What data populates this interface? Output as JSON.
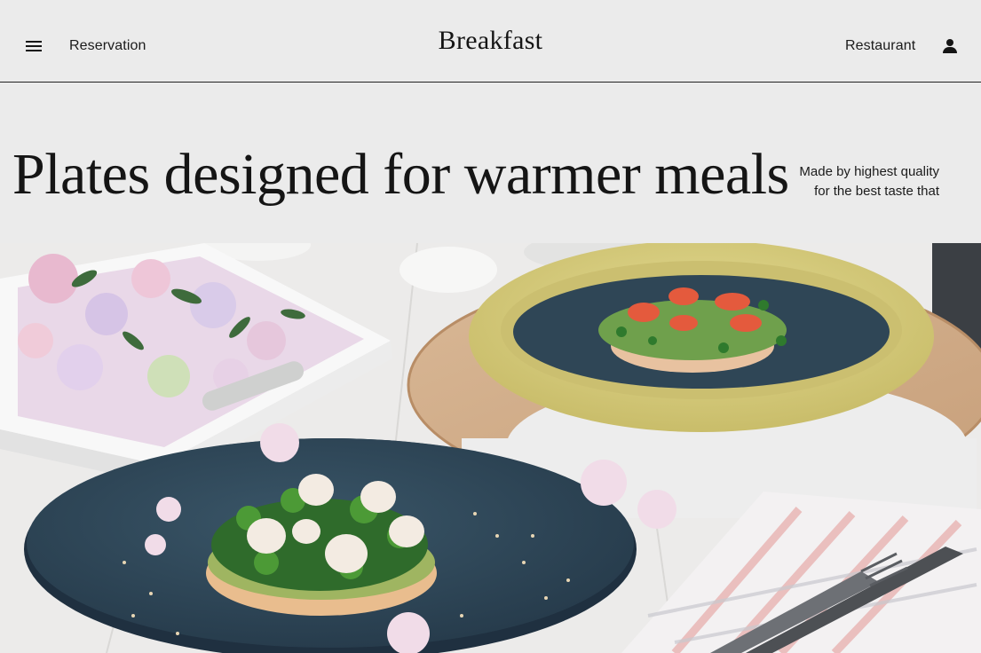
{
  "header": {
    "menu_icon": "menu-icon",
    "left_link": "Reservation",
    "logo": "Breakfast",
    "right_link": "Restaurant",
    "user_icon": "person-icon"
  },
  "hero": {
    "title": "Plates designed for warmer meals",
    "subtitle_line1": "Made by highest quality",
    "subtitle_line2": "for the best taste that"
  },
  "photo": {
    "subject": "breakfast-plates-photo"
  },
  "colors": {
    "background": "#ebebeb",
    "text": "#151515",
    "plate_blue": "#2f4656",
    "bowl_yellow": "#d8cf82"
  }
}
